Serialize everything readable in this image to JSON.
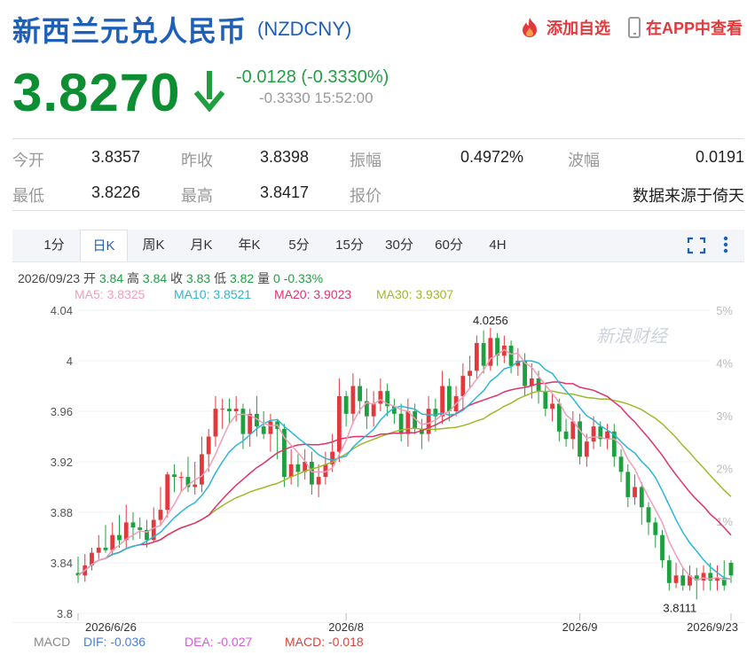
{
  "header": {
    "title": "新西兰元兑人民币",
    "code": "(NZDCNY)",
    "add_watch": "添加自选",
    "view_app": "在APP中查看"
  },
  "quote": {
    "price": "3.8270",
    "change": "-0.0128 (-0.3330%)",
    "change_pct": "-0.3330",
    "time": "15:52:00",
    "direction": "down",
    "down_color": "#1fa03f",
    "up_color": "#e4393c"
  },
  "stats": {
    "open_label": "今开",
    "open": "3.8357",
    "prev_close_label": "昨收",
    "prev_close": "3.8398",
    "amplitude_label": "振幅",
    "amplitude": "0.4972%",
    "wave_label": "波幅",
    "wave": "0.0191",
    "low_label": "最低",
    "low": "3.8226",
    "high_label": "最高",
    "high": "3.8417",
    "bid_label": "报价",
    "source": "数据来源于倚天"
  },
  "tabs": [
    {
      "label": "1分",
      "active": false
    },
    {
      "label": "日K",
      "active": true
    },
    {
      "label": "周K",
      "active": false
    },
    {
      "label": "月K",
      "active": false
    },
    {
      "label": "年K",
      "active": false
    },
    {
      "label": "5分",
      "active": false
    },
    {
      "label": "15分",
      "active": false
    },
    {
      "label": "30分",
      "active": false
    },
    {
      "label": "60分",
      "active": false
    },
    {
      "label": "4H",
      "active": false
    }
  ],
  "ohlc": {
    "date": "2026/09/23",
    "open_label": "开",
    "open": "3.84",
    "high_label": "高",
    "high": "3.84",
    "close_label": "收",
    "close": "3.83",
    "low_label": "低",
    "low": "3.82",
    "vol_label": "量",
    "vol": "0",
    "pct": "-0.33%"
  },
  "ma": {
    "ma5": "MA5: 3.8325",
    "ma10": "MA10: 3.8521",
    "ma20": "MA20: 3.9023",
    "ma30": "MA30: 3.9307",
    "ma5_color": "#f39cb9",
    "ma10_color": "#2bb6d9",
    "ma20_color": "#e0336a",
    "ma30_color": "#9fb82c"
  },
  "watermark": "新浪财经",
  "macd": {
    "label": "MACD",
    "dif": "DIF: -0.036",
    "dea": "DEA: -0.027",
    "macd": "MACD: -0.018"
  },
  "chart_data": {
    "type": "candlestick",
    "y_ticks": [
      "4.04",
      "4",
      "3.96",
      "3.92",
      "3.88",
      "3.84",
      "3.8"
    ],
    "pct_ticks": [
      "5%",
      "4%",
      "3%",
      "2%",
      "1%"
    ],
    "x_labels": [
      "2026/6/26",
      "2026/8",
      "2026/9",
      "2026/9/23"
    ],
    "x_label_index": [
      0,
      39,
      73,
      95
    ],
    "max_label": "4.0256",
    "min_label": "3.8111",
    "ylim": [
      3.8,
      4.04
    ],
    "candles": [
      [
        3.832,
        3.83,
        3.845,
        3.824
      ],
      [
        3.83,
        3.838,
        3.847,
        3.825
      ],
      [
        3.838,
        3.848,
        3.852,
        3.834
      ],
      [
        3.848,
        3.852,
        3.862,
        3.843
      ],
      [
        3.852,
        3.85,
        3.87,
        3.848
      ],
      [
        3.85,
        3.862,
        3.872,
        3.846
      ],
      [
        3.862,
        3.858,
        3.878,
        3.852
      ],
      [
        3.858,
        3.872,
        3.886,
        3.852
      ],
      [
        3.872,
        3.868,
        3.88,
        3.858
      ],
      [
        3.868,
        3.866,
        3.876,
        3.859
      ],
      [
        3.866,
        3.858,
        3.874,
        3.852
      ],
      [
        3.858,
        3.874,
        3.884,
        3.856
      ],
      [
        3.874,
        3.882,
        3.9,
        3.87
      ],
      [
        3.882,
        3.91,
        3.912,
        3.876
      ],
      [
        3.91,
        3.908,
        3.918,
        3.896
      ],
      [
        3.908,
        3.908,
        3.912,
        3.896
      ],
      [
        3.908,
        3.9,
        3.924,
        3.896
      ],
      [
        3.9,
        3.902,
        3.92,
        3.894
      ],
      [
        3.902,
        3.926,
        3.94,
        3.896
      ],
      [
        3.926,
        3.94,
        3.946,
        3.912
      ],
      [
        3.94,
        3.962,
        3.972,
        3.932
      ],
      [
        3.962,
        3.962,
        3.97,
        3.946
      ],
      [
        3.962,
        3.96,
        3.97,
        3.95
      ],
      [
        3.96,
        3.962,
        3.972,
        3.952
      ],
      [
        3.962,
        3.942,
        3.966,
        3.93
      ],
      [
        3.942,
        3.958,
        3.962,
        3.932
      ],
      [
        3.958,
        3.948,
        3.972,
        3.94
      ],
      [
        3.948,
        3.942,
        3.96,
        3.938
      ],
      [
        3.942,
        3.952,
        3.958,
        3.928
      ],
      [
        3.952,
        3.946,
        3.954,
        3.922
      ],
      [
        3.946,
        3.908,
        3.95,
        3.9
      ],
      [
        3.908,
        3.918,
        3.93,
        3.902
      ],
      [
        3.918,
        3.912,
        3.926,
        3.9
      ],
      [
        3.912,
        3.92,
        3.93,
        3.906
      ],
      [
        3.92,
        3.902,
        3.928,
        3.894
      ],
      [
        3.902,
        3.908,
        3.918,
        3.892
      ],
      [
        3.908,
        3.918,
        3.928,
        3.902
      ],
      [
        3.918,
        3.928,
        3.942,
        3.912
      ],
      [
        3.928,
        3.972,
        3.986,
        3.92
      ],
      [
        3.972,
        3.958,
        3.976,
        3.948
      ],
      [
        3.958,
        3.98,
        3.99,
        3.95
      ],
      [
        3.98,
        3.968,
        3.986,
        3.958
      ],
      [
        3.968,
        3.956,
        3.978,
        3.946
      ],
      [
        3.956,
        3.966,
        3.976,
        3.948
      ],
      [
        3.966,
        3.976,
        3.986,
        3.96
      ],
      [
        3.976,
        3.964,
        3.982,
        3.956
      ],
      [
        3.964,
        3.958,
        3.97,
        3.95
      ],
      [
        3.958,
        3.942,
        3.966,
        3.936
      ],
      [
        3.942,
        3.96,
        3.97,
        3.932
      ],
      [
        3.96,
        3.946,
        3.966,
        3.942
      ],
      [
        3.946,
        3.942,
        3.954,
        3.93
      ],
      [
        3.942,
        3.962,
        3.972,
        3.936
      ],
      [
        3.962,
        3.956,
        3.97,
        3.944
      ],
      [
        3.956,
        3.98,
        3.992,
        3.95
      ],
      [
        3.98,
        3.96,
        3.986,
        3.952
      ],
      [
        3.96,
        3.972,
        3.98,
        3.956
      ],
      [
        3.972,
        3.988,
        3.998,
        3.962
      ],
      [
        3.988,
        3.992,
        4.004,
        3.978
      ],
      [
        3.992,
        4.014,
        4.02,
        3.986
      ],
      [
        4.014,
        3.996,
        4.024,
        3.99
      ],
      [
        3.996,
        4.018,
        4.026,
        3.992
      ],
      [
        4.018,
        4.004,
        4.022,
        3.996
      ],
      [
        4.004,
        4.012,
        4.02,
        3.998
      ],
      [
        4.012,
        3.996,
        4.016,
        3.99
      ],
      [
        3.996,
        4.0,
        4.01,
        3.988
      ],
      [
        4.0,
        3.98,
        4.006,
        3.972
      ],
      [
        3.98,
        3.986,
        3.998,
        3.97
      ],
      [
        3.986,
        3.976,
        3.992,
        3.966
      ],
      [
        3.976,
        3.962,
        3.982,
        3.956
      ],
      [
        3.962,
        3.966,
        3.974,
        3.952
      ],
      [
        3.966,
        3.944,
        3.97,
        3.936
      ],
      [
        3.944,
        3.938,
        3.954,
        3.932
      ],
      [
        3.938,
        3.952,
        3.96,
        3.93
      ],
      [
        3.952,
        3.924,
        3.958,
        3.918
      ],
      [
        3.924,
        3.936,
        3.942,
        3.916
      ],
      [
        3.936,
        3.948,
        3.956,
        3.93
      ],
      [
        3.948,
        3.938,
        3.952,
        3.932
      ],
      [
        3.938,
        3.944,
        3.95,
        3.93
      ],
      [
        3.944,
        3.924,
        3.95,
        3.916
      ],
      [
        3.924,
        3.912,
        3.93,
        3.904
      ],
      [
        3.912,
        3.892,
        3.918,
        3.884
      ],
      [
        3.892,
        3.9,
        3.91,
        3.886
      ],
      [
        3.9,
        3.884,
        3.904,
        3.87
      ],
      [
        3.884,
        3.872,
        3.888,
        3.862
      ],
      [
        3.872,
        3.862,
        3.876,
        3.852
      ],
      [
        3.862,
        3.842,
        3.866,
        3.836
      ],
      [
        3.842,
        3.824,
        3.846,
        3.818
      ],
      [
        3.824,
        3.83,
        3.84,
        3.82
      ],
      [
        3.83,
        3.822,
        3.836,
        3.818
      ],
      [
        3.822,
        3.83,
        3.838,
        3.818
      ],
      [
        3.83,
        3.826,
        3.836,
        3.811
      ],
      [
        3.826,
        3.832,
        3.838,
        3.818
      ],
      [
        3.832,
        3.826,
        3.84,
        3.818
      ],
      [
        3.826,
        3.828,
        3.838,
        3.818
      ],
      [
        3.828,
        3.822,
        3.842,
        3.818
      ],
      [
        3.84,
        3.83,
        3.842,
        3.824
      ]
    ]
  }
}
